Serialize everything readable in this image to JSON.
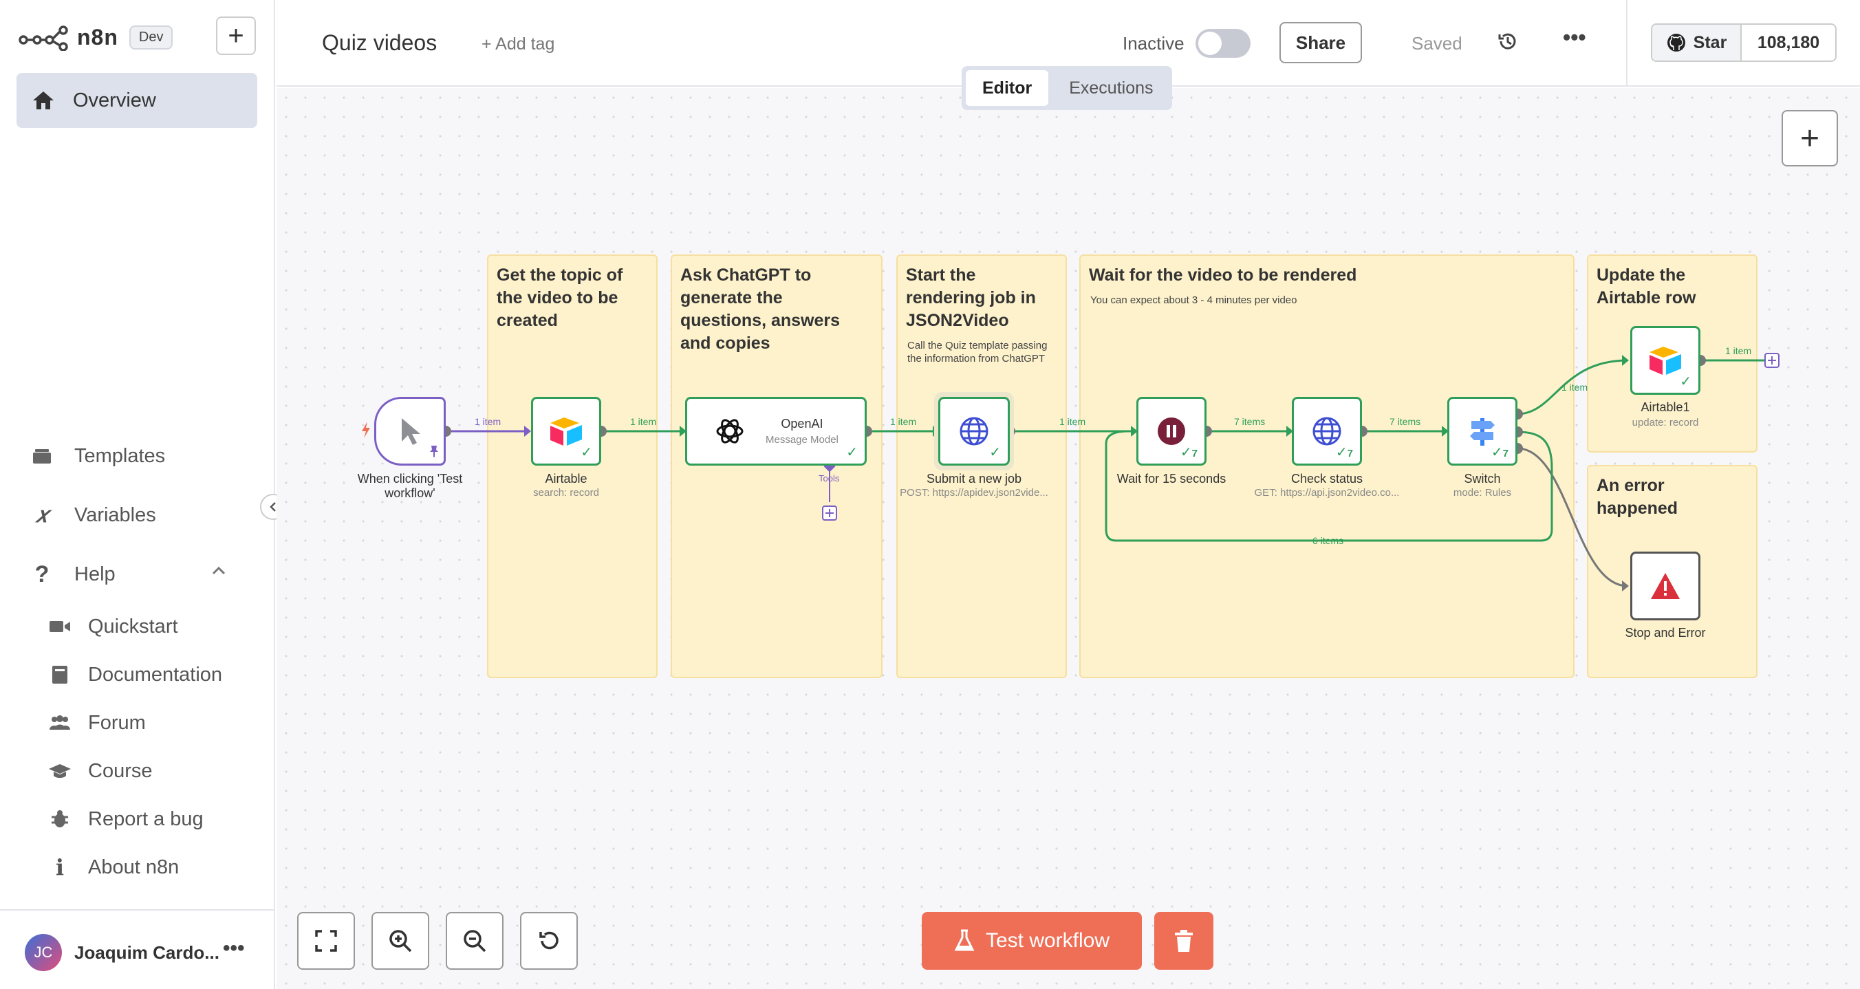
{
  "brand": {
    "name": "n8n",
    "env_badge": "Dev"
  },
  "sidebar": {
    "overview": "Overview",
    "templates": "Templates",
    "variables": "Variables",
    "help": "Help",
    "help_items": [
      "Quickstart",
      "Documentation",
      "Forum",
      "Course",
      "Report a bug",
      "About n8n"
    ],
    "user": {
      "initials": "JC",
      "name": "Joaquim Cardo..."
    }
  },
  "header": {
    "workflow_name": "Quiz videos",
    "add_tag": "+ Add tag",
    "status": "Inactive",
    "share": "Share",
    "saved": "Saved",
    "github_star": "Star",
    "github_count": "108,180",
    "tabs": [
      "Editor",
      "Executions"
    ]
  },
  "stickies": [
    {
      "title": "Get the topic of the video to be created",
      "note": ""
    },
    {
      "title": "Ask ChatGPT to generate the questions, answers and copies",
      "note": ""
    },
    {
      "title": "Start the rendering job in JSON2Video",
      "note": "Call the Quiz template passing the information from ChatGPT"
    },
    {
      "title": "Wait for the video to be rendered",
      "note": "You can expect about 3 - 4 minutes per video"
    },
    {
      "title": "Update the Airtable row",
      "note": ""
    },
    {
      "title": "An error happened",
      "note": ""
    }
  ],
  "nodes": {
    "trigger": {
      "label": "When clicking 'Test workflow'"
    },
    "airtable": {
      "label": "Airtable",
      "sub": "search: record"
    },
    "openai": {
      "title": "OpenAI",
      "sub": "Message Model",
      "tools": "Tools"
    },
    "submit": {
      "label": "Submit a new job",
      "sub": "POST: https://apidev.json2vide..."
    },
    "wait": {
      "label": "Wait for 15 seconds",
      "count": "7"
    },
    "check": {
      "label": "Check status",
      "sub": "GET: https://api.json2video.co...",
      "count": "7"
    },
    "switch": {
      "label": "Switch",
      "sub": "mode: Rules",
      "count": "7"
    },
    "airtable1": {
      "label": "Airtable1",
      "sub": "update: record"
    },
    "stop": {
      "label": "Stop and Error"
    }
  },
  "edges": {
    "e1": "1 item",
    "e2": "1 item",
    "e3": "1 item",
    "e4": "1 item",
    "e5": "7 items",
    "e6": "7 items",
    "e7": "1 item",
    "e8": "1 item",
    "loop": "6 items"
  },
  "footer": {
    "test_workflow": "Test workflow"
  },
  "colors": {
    "accent": "#ef6e56",
    "success": "#2f9e59",
    "sticky": "#fdf2cc",
    "trigger": "#7b5fc4"
  }
}
